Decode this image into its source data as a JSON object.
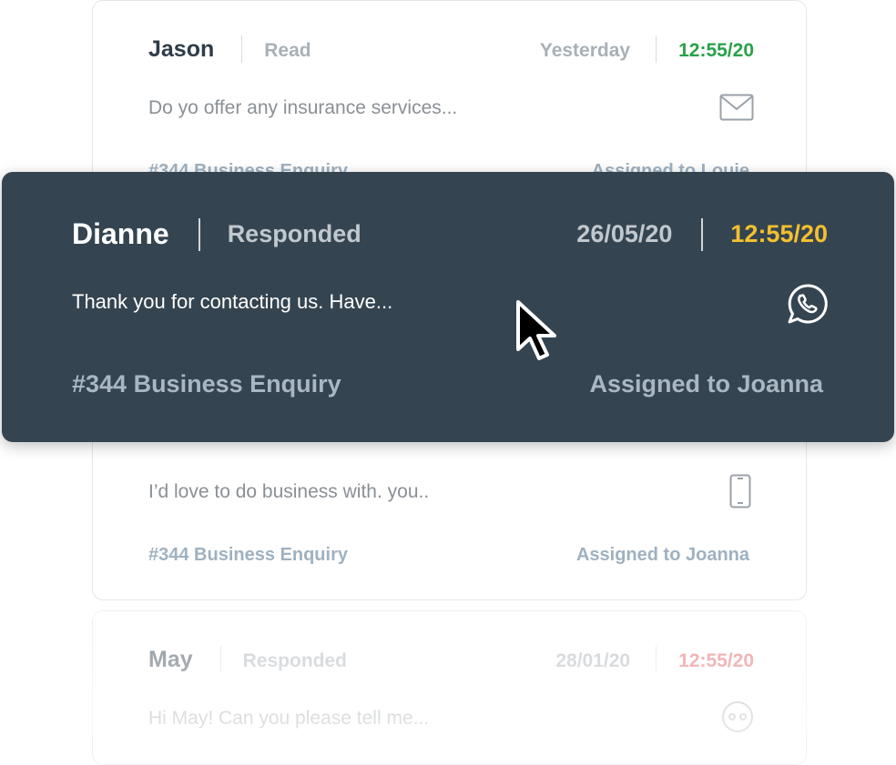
{
  "cards": [
    {
      "name": "Jason",
      "status": "Read",
      "date": "Yesterday",
      "time": "12:55/20",
      "time_color": "#2aa14a",
      "snippet": "Do yo offer any insurance services...",
      "channel_icon": "mail-icon",
      "tag": "#344 Business Enquiry",
      "assigned": "Assigned to Louie"
    },
    {
      "name": "Dianne",
      "status": "Responded",
      "date": "26/05/20",
      "time": "12:55/20",
      "time_color": "#f4c02f",
      "snippet": "Thank you for contacting us. Have...",
      "channel_icon": "whatsapp-icon",
      "tag": "#344 Business Enquiry",
      "assigned": "Assigned to Joanna",
      "highlighted": true
    },
    {
      "snippet": "I’d love to do business with. you..",
      "channel_icon": "phone-icon",
      "tag": "#344 Business Enquiry",
      "assigned": "Assigned to Joanna"
    },
    {
      "name": "May",
      "status": "Responded",
      "date": "28/01/20",
      "time": "12:55/20",
      "time_color": "#e0585b",
      "snippet": "Hi May! Can you please tell me...",
      "channel_icon": "chat-bot-icon"
    }
  ],
  "accent": "#344450"
}
